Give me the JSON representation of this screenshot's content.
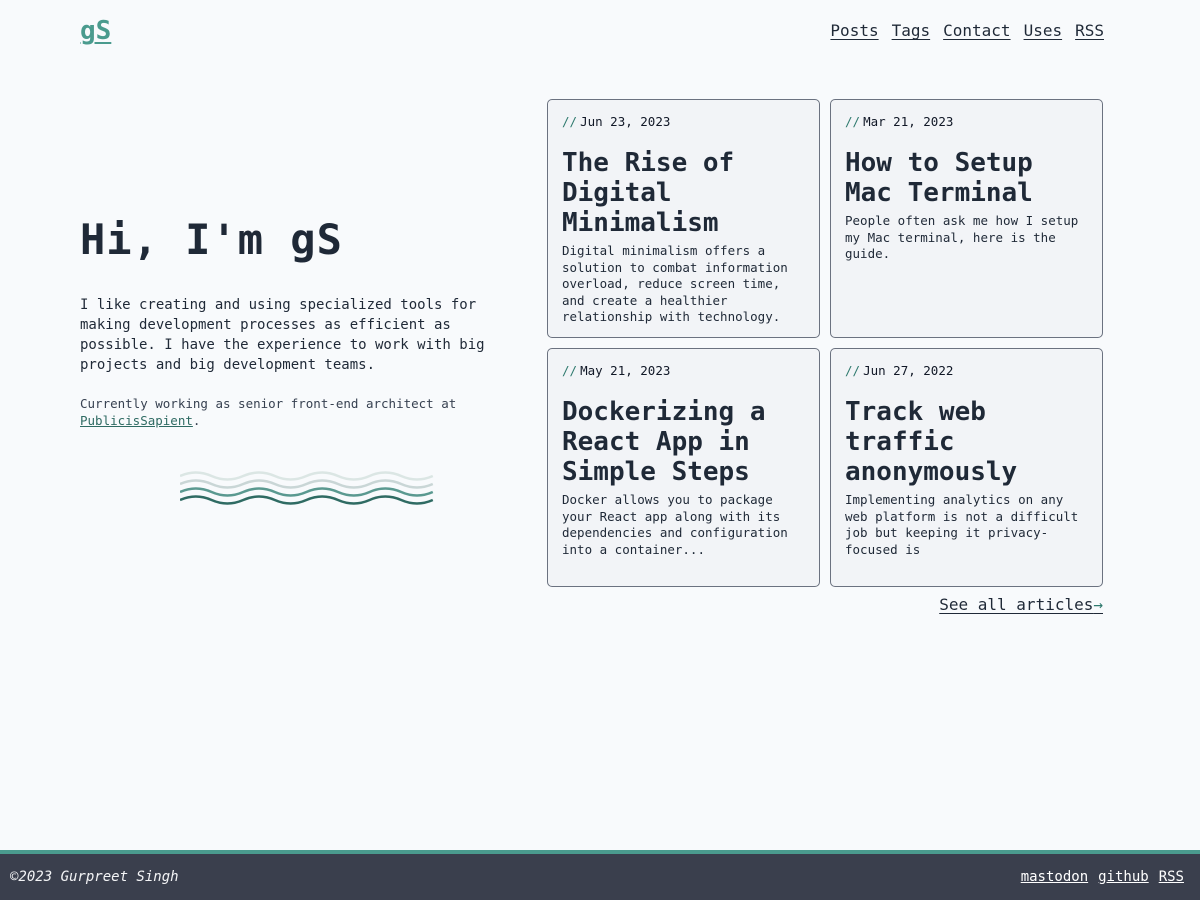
{
  "header": {
    "logo": "gS",
    "nav": [
      "Posts",
      "Tags",
      "Contact",
      "Uses",
      "RSS"
    ]
  },
  "hero": {
    "title": "Hi, I'm gS",
    "intro": "I like creating and using specialized tools for making development processes as efficient as possible. I have the experience to work with big projects and big development teams.",
    "working_prefix": "Currently working as senior front-end architect at ",
    "company": "PublicisSapient",
    "working_suffix": "."
  },
  "articles": [
    {
      "date_prefix": "//",
      "date": "Jun 23, 2023",
      "title": "The Rise of Digital Minimalism",
      "excerpt": "Digital minimalism offers a solution to combat information overload, reduce screen time, and create a healthier relationship with technology."
    },
    {
      "date_prefix": "//",
      "date": "Mar 21, 2023",
      "title": "How to Setup Mac Terminal",
      "excerpt": "People often ask me how I setup my Mac terminal, here is the guide."
    },
    {
      "date_prefix": "//",
      "date": "May 21, 2023",
      "title": "Dockerizing a React App in Simple Steps",
      "excerpt": "Docker allows you to package your React app along with its dependencies and configuration into a container..."
    },
    {
      "date_prefix": "//",
      "date": "Jun 27, 2022",
      "title": "Track web traffic anonymously",
      "excerpt": "Implementing analytics on any web platform is not a difficult job but keeping it privacy-focused is"
    }
  ],
  "see_all": {
    "label": "See all articles",
    "arrow": "→"
  },
  "footer": {
    "copyright": "©2023 Gurpreet Singh",
    "links": [
      "mastodon",
      "github",
      "RSS"
    ]
  },
  "colors": {
    "accent": "#4a9b8e",
    "text": "#1f2937",
    "background": "#f8fafc",
    "footer_bg": "#3a3f4d"
  }
}
